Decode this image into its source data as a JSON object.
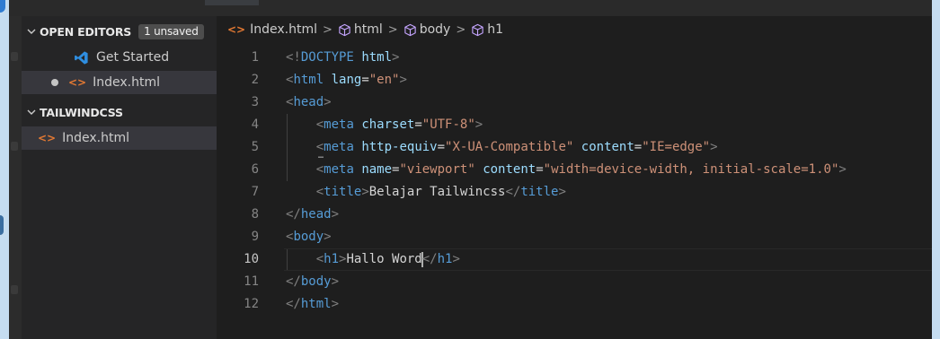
{
  "sidebar": {
    "open_editors": {
      "title": "OPEN EDITORS",
      "badge": "1 unsaved",
      "items": [
        {
          "label": "Get Started",
          "icon": "vscode-logo-icon"
        },
        {
          "label": "Index.html",
          "icon": "html-file-icon",
          "dirty": true
        }
      ]
    },
    "workspace": {
      "title": "TAILWINDCSS",
      "items": [
        {
          "label": "Index.html",
          "icon": "html-file-icon"
        }
      ]
    }
  },
  "breadcrumb": {
    "file_icon": "<>",
    "file": "Index.html",
    "items": [
      "html",
      "body",
      "h1"
    ],
    "separator": ">"
  },
  "editor": {
    "current_line": 10,
    "lines": [
      {
        "n": "1",
        "tokens": [
          [
            "t",
            "<!"
          ],
          [
            "n",
            "DOCTYPE"
          ],
          [
            "x",
            " "
          ],
          [
            "a",
            "html"
          ],
          [
            "t",
            ">"
          ]
        ]
      },
      {
        "n": "2",
        "tokens": [
          [
            "t",
            "<"
          ],
          [
            "n",
            "html"
          ],
          [
            "x",
            " "
          ],
          [
            "a",
            "lang"
          ],
          [
            "x",
            "="
          ],
          [
            "s",
            "\"en\""
          ],
          [
            "t",
            ">"
          ]
        ]
      },
      {
        "n": "3",
        "tokens": [
          [
            "t",
            "<"
          ],
          [
            "n",
            "head"
          ],
          [
            "t",
            ">"
          ]
        ]
      },
      {
        "n": "4",
        "tokens": [
          [
            "x",
            "    "
          ],
          [
            "t",
            "<"
          ],
          [
            "n",
            "meta"
          ],
          [
            "x",
            " "
          ],
          [
            "a",
            "charset"
          ],
          [
            "x",
            "="
          ],
          [
            "s",
            "\"UTF-8\""
          ],
          [
            "t",
            ">"
          ]
        ]
      },
      {
        "n": "5",
        "tokens": [
          [
            "x",
            "    "
          ],
          [
            "t",
            "<"
          ],
          [
            "n",
            "meta"
          ],
          [
            "x",
            " "
          ],
          [
            "a",
            "http-equiv"
          ],
          [
            "x",
            "="
          ],
          [
            "s",
            "\"X-UA-Compatible\""
          ],
          [
            "x",
            " "
          ],
          [
            "a",
            "content"
          ],
          [
            "x",
            "="
          ],
          [
            "s",
            "\"IE=edge\""
          ],
          [
            "t",
            ">"
          ]
        ]
      },
      {
        "n": "6",
        "tokens": [
          [
            "x",
            "    "
          ],
          [
            "t",
            "<"
          ],
          [
            "n",
            "meta"
          ],
          [
            "x",
            " "
          ],
          [
            "a",
            "name"
          ],
          [
            "x",
            "="
          ],
          [
            "s",
            "\"viewport\""
          ],
          [
            "x",
            " "
          ],
          [
            "a",
            "content"
          ],
          [
            "x",
            "="
          ],
          [
            "s",
            "\"width=device-width, initial-scale=1.0\""
          ],
          [
            "t",
            ">"
          ]
        ]
      },
      {
        "n": "7",
        "tokens": [
          [
            "x",
            "    "
          ],
          [
            "t",
            "<"
          ],
          [
            "n",
            "title"
          ],
          [
            "t",
            ">"
          ],
          [
            "x",
            "Belajar Tailwincss"
          ],
          [
            "t",
            "</"
          ],
          [
            "n",
            "title"
          ],
          [
            "t",
            ">"
          ]
        ]
      },
      {
        "n": "8",
        "tokens": [
          [
            "t",
            "</"
          ],
          [
            "n",
            "head"
          ],
          [
            "t",
            ">"
          ]
        ]
      },
      {
        "n": "9",
        "tokens": [
          [
            "t",
            "<"
          ],
          [
            "n",
            "body"
          ],
          [
            "t",
            ">"
          ]
        ]
      },
      {
        "n": "10",
        "tokens": [
          [
            "x",
            "    "
          ],
          [
            "t",
            "<"
          ],
          [
            "n",
            "h1"
          ],
          [
            "t",
            ">"
          ],
          [
            "x",
            "Hallo Word"
          ],
          [
            "caret",
            ""
          ],
          [
            "t",
            "</"
          ],
          [
            "n",
            "h1"
          ],
          [
            "t",
            ">"
          ]
        ]
      },
      {
        "n": "11",
        "tokens": [
          [
            "t",
            "</"
          ],
          [
            "n",
            "body"
          ],
          [
            "t",
            ">"
          ]
        ]
      },
      {
        "n": "12",
        "tokens": [
          [
            "t",
            "</"
          ],
          [
            "n",
            "html"
          ],
          [
            "t",
            ">"
          ]
        ]
      }
    ]
  },
  "colors": {
    "background": "#1e1e1e",
    "sidebar": "#252526",
    "tag": "#569cd6",
    "attribute": "#9cdcfe",
    "string": "#ce9178",
    "punctuation": "#808080",
    "html_icon": "#e37933",
    "vscode_logo": "#2f8ee0"
  }
}
